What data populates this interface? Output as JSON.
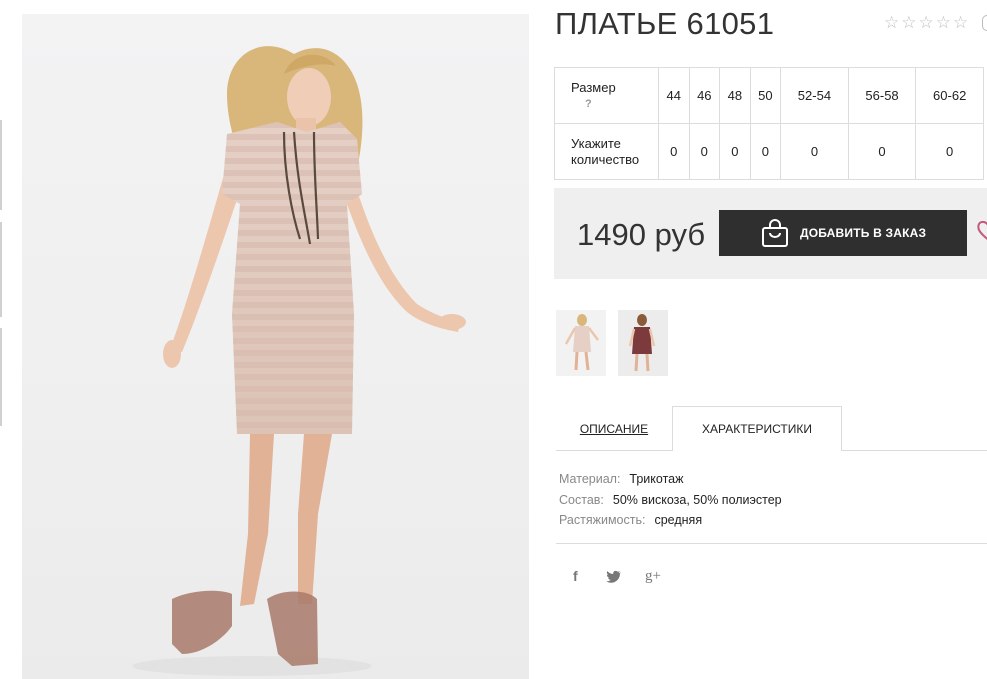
{
  "product": {
    "title": "ПЛАТЬЕ 61051",
    "rating_stars": [
      "☆",
      "☆",
      "☆",
      "☆",
      "☆"
    ]
  },
  "size_table": {
    "size_label": "Размер",
    "help_mark": "?",
    "qty_label_line1": "Укажите",
    "qty_label_line2": "количество",
    "sizes": [
      "44",
      "46",
      "48",
      "50",
      "52-54",
      "56-58",
      "60-62"
    ],
    "quantities": [
      "0",
      "0",
      "0",
      "0",
      "0",
      "0",
      "0"
    ]
  },
  "purchase": {
    "price": "1490 руб",
    "order_button": "ДОБАВИТЬ В ЗАКАЗ",
    "icons": [
      "shopping-bag-icon",
      "heart-icon"
    ]
  },
  "tabs": {
    "description": "ОПИСАНИЕ",
    "characteristics": "ХАРАКТЕРИСТИКИ",
    "active": "characteristics"
  },
  "specs": [
    {
      "key": "Материал:",
      "value": "Трикотаж"
    },
    {
      "key": "Состав:",
      "value": "50% вискоза, 50% полиэстер"
    },
    {
      "key": "Растяжимость:",
      "value": "средняя"
    }
  ],
  "social": {
    "facebook": "f",
    "google_plus": "g+"
  },
  "colors": {
    "button_bg": "#2f2f2f",
    "price_panel": "#efefef",
    "dress_beige": "#e3cbc0",
    "dress_burgundy": "#7d3a3c"
  }
}
